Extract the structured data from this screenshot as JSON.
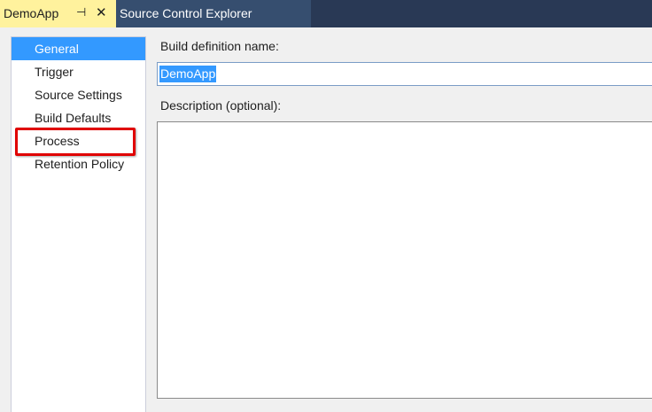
{
  "tabs": {
    "active": {
      "title": "DemoApp",
      "pin_glyph": "⊣",
      "close_glyph": "✕"
    },
    "inactive": {
      "title": "Source Control Explorer"
    }
  },
  "nav": {
    "items": [
      {
        "label": "General",
        "selected": true
      },
      {
        "label": "Trigger"
      },
      {
        "label": "Source Settings"
      },
      {
        "label": "Build Defaults"
      },
      {
        "label": "Process",
        "highlighted": true
      },
      {
        "label": "Retention Policy"
      }
    ]
  },
  "form": {
    "name_label": "Build definition name:",
    "name_value": "DemoApp",
    "description_label": "Description (optional):",
    "description_value": ""
  },
  "colors": {
    "tab_active_bg": "#fff29d",
    "tab_strip_bg": "#293955",
    "selection": "#3399ff",
    "highlight_border": "#e00000"
  },
  "icons": {
    "pin": "pin-icon",
    "close": "close-icon"
  }
}
